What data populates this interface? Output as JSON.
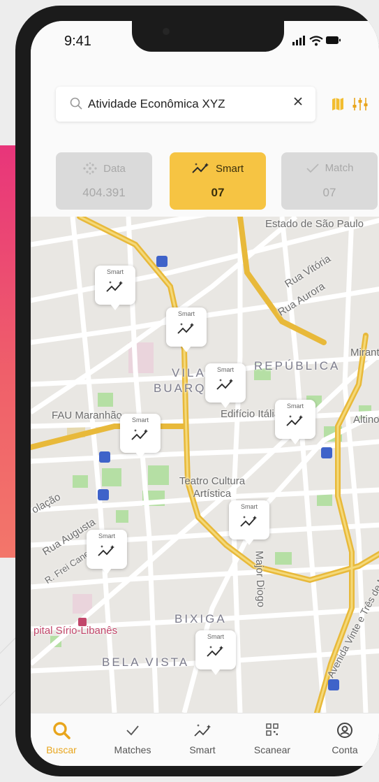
{
  "status": {
    "time": "9:41"
  },
  "search": {
    "value": "Atividade Econômica XYZ",
    "placeholder": ""
  },
  "modes": [
    {
      "label": "Data",
      "count": "404.391",
      "active": false
    },
    {
      "label": "Smart",
      "count": "07",
      "active": true
    },
    {
      "label": "Match",
      "count": "07",
      "active": false
    }
  ],
  "map": {
    "labels": {
      "estado": "Estado de São Paulo",
      "rua_vitoria": "Rua Vitória",
      "rua_aurora": "Rua Aurora",
      "republica": "REPÚBLICA",
      "mirante": "Mirante",
      "vila": "VILA",
      "buarque": "BUARQUE",
      "edificio": "Edifício Itália",
      "altino": "Altino A",
      "fau": "FAU Maranhão",
      "teatro": "Teatro Cultura Artística",
      "consolacao": "olação",
      "rua_augusta": "Rua Augusta",
      "frei_caneca": "R. Frei Caneca",
      "major_diogo": "Major Diogo",
      "tres_de_maio": "Avenida Vinte e Três de Maio",
      "bixiga": "BIXIGA",
      "hospital": "pital Sírio-Libanês",
      "bela_vista": "BELA VISTA"
    },
    "pin_label": "Smart"
  },
  "tabs": [
    {
      "label": "Buscar",
      "icon": "search-icon",
      "active": true
    },
    {
      "label": "Matches",
      "icon": "check-icon",
      "active": false
    },
    {
      "label": "Smart",
      "icon": "smart-icon",
      "active": false
    },
    {
      "label": "Scanear",
      "icon": "qr-scan-icon",
      "active": false
    },
    {
      "label": "Conta",
      "icon": "account-icon",
      "active": false
    }
  ],
  "colors": {
    "accent": "#f6c443",
    "active_tab": "#e8a51c",
    "road_major": "#e8b93a",
    "park": "#b5dfa4",
    "brand_stripe": "#e8357a"
  }
}
